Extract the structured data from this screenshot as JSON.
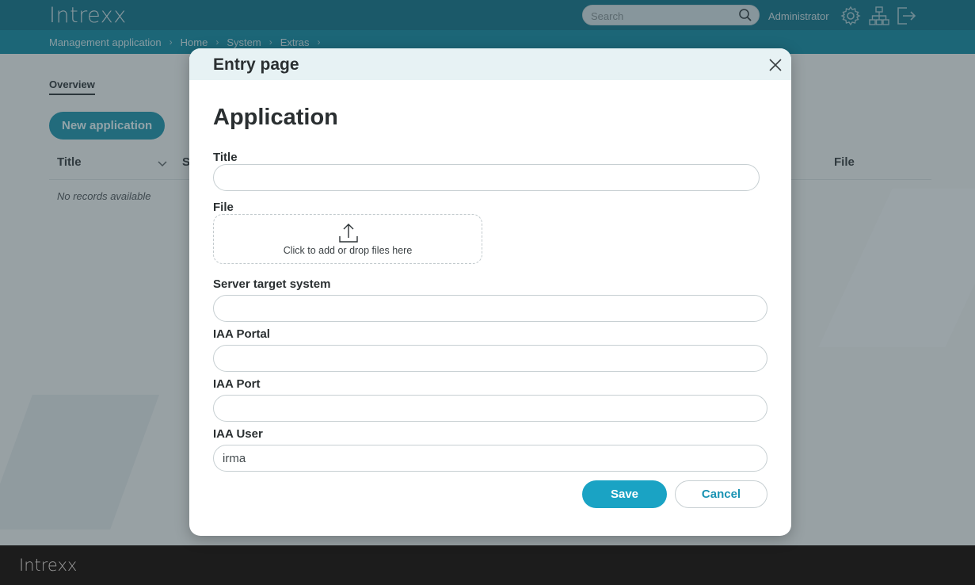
{
  "app": {
    "brand": "Intrexx",
    "footer_brand": "Intrexx",
    "search_placeholder": "Search",
    "user": "Administrator",
    "breadcrumbs": [
      "Management application",
      "Home",
      "System",
      "Extras"
    ]
  },
  "background": {
    "tab_overview": "Overview",
    "new_application_button": "New application",
    "columns": [
      "Title",
      "S",
      "File"
    ],
    "empty_text": "No records available"
  },
  "dialog": {
    "title": "Entry page",
    "section_title": "Application",
    "fields": {
      "title": {
        "label": "Title",
        "value": ""
      },
      "file": {
        "label": "File",
        "dropzone_text": "Click to add or drop files here"
      },
      "server_target_system": {
        "label": "Server target system",
        "value": ""
      },
      "iaa_portal": {
        "label": "IAA Portal",
        "value": ""
      },
      "iaa_port": {
        "label": "IAA Port",
        "value": ""
      },
      "iaa_user": {
        "label": "IAA User",
        "value": "irma"
      }
    },
    "save_label": "Save",
    "cancel_label": "Cancel"
  },
  "colors": {
    "topbar": "#0f6f86",
    "breadcrumb_bar": "#11869e",
    "accent": "#1aa3c4",
    "footer": "#1c1c1c"
  },
  "icons": [
    "search-icon",
    "gear-icon",
    "sitemap-icon",
    "logout-icon",
    "close-icon",
    "upload-icon",
    "chevron-down-icon"
  ]
}
